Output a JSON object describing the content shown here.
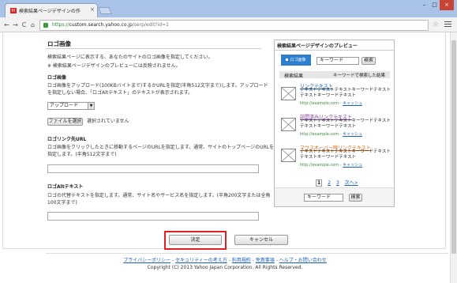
{
  "browser": {
    "tab_title": "検索結果ページデザインの作",
    "tab_close": "×",
    "window_min": "–",
    "window_max": "□",
    "window_close": "×",
    "back": "←",
    "forward": "→",
    "reload": "C",
    "home": "⌂",
    "url_scheme": "https://",
    "url_host": "custom.search.yahoo.co.jp",
    "url_path": "/serp/edit?id=1",
    "star": "☆"
  },
  "form": {
    "section_title": "ロゴ画像",
    "intro": "検索結果ページに表示する、あなたのサイトのロゴ画像を指定してください。",
    "note": "※ 検索結果ページデザインのプレビューには反映されません。",
    "logo_label": "ロゴ画像",
    "logo_desc_1": "ロゴ画像をアップロード(100KBバイトまで)するかURLを指定(半角512文字まで)します。アップロード",
    "logo_desc_2": "を指定しない場合、「ロゴAltテキスト」のテキストが表示されます。",
    "select_value": "アップロード",
    "select_arrow": "▼",
    "file_button": "ファイルを選択",
    "file_status": "選択されていません",
    "link_label": "ロゴリンク先URL",
    "link_desc_1": "ロゴ画像をクリックしたときに移動するページのURLを指定します。通常、サイトのトップページのURLを",
    "link_desc_2": "指定します。(半角512文字まで)",
    "alt_label": "ロゴAltテキスト",
    "alt_desc_1": "ロゴの代替テキストを指定します。通常、サイト名やサービス名を指定します。(半角200文字または全角",
    "alt_desc_2": "100文字まで)"
  },
  "preview": {
    "title": "検索結果ページデザインのプレビュー",
    "logo_text": "ロゴ画像",
    "search_value": "キーワード",
    "search_button": "検索",
    "bar_left": "検索結果",
    "bar_right": "キーワードで検索した結果",
    "items": [
      {
        "link": "リンクテキスト",
        "desc": "テキストテキストテキストキーワードテキストテキストキーワードテキスト",
        "url": "http://example.com",
        "sep": " - ",
        "cache": "キャッシュ"
      },
      {
        "link": "訪問済みリンクテキスト",
        "desc": "テキストテキストテキストキーワードテキストテキストキーワードテキスト",
        "url": "http://example.com",
        "sep": " - ",
        "cache": "キャッシュ"
      },
      {
        "link": "マウスオーバー時リンクテキスト",
        "desc": "テキストテキストテキストキーワードテキストテキストキーワードテキスト",
        "url": "http://example.com",
        "sep": " - ",
        "cache": "キャッシュ"
      }
    ],
    "pages": [
      "1",
      "2",
      "3",
      "次へ>"
    ],
    "bottom_search_value": "キーワード",
    "bottom_search_button": "検索"
  },
  "actions": {
    "ok": "決定",
    "cancel": "キャンセル"
  },
  "footer": {
    "links": [
      "プライバシーポリシー",
      "セキュリティーの考え方",
      "利用規約",
      "免責事項",
      "ヘルプ・お問い合わせ"
    ],
    "separator": " - ",
    "copyright": "Copyright (C) 2013 Yahoo Japan Corporation. All Rights Reserved."
  }
}
